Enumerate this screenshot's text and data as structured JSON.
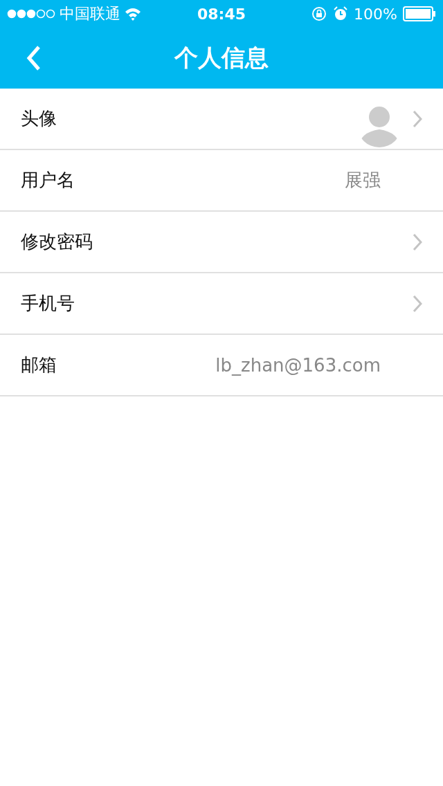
{
  "status_bar": {
    "carrier": "中国联通",
    "time": "08:45",
    "battery": "100%"
  },
  "nav_bar": {
    "title": "个人信息"
  },
  "rows": [
    {
      "kind": "avatar",
      "label": "头像",
      "arrow": true
    },
    {
      "kind": "value",
      "label": "用户名",
      "value": "展强",
      "arrow": false
    },
    {
      "kind": "link",
      "label": "修改密码",
      "arrow": true
    },
    {
      "kind": "link",
      "label": "手机号",
      "arrow": true
    },
    {
      "kind": "value",
      "label": "邮箱",
      "value": "lb_zhan@163.com",
      "arrow": false
    }
  ]
}
